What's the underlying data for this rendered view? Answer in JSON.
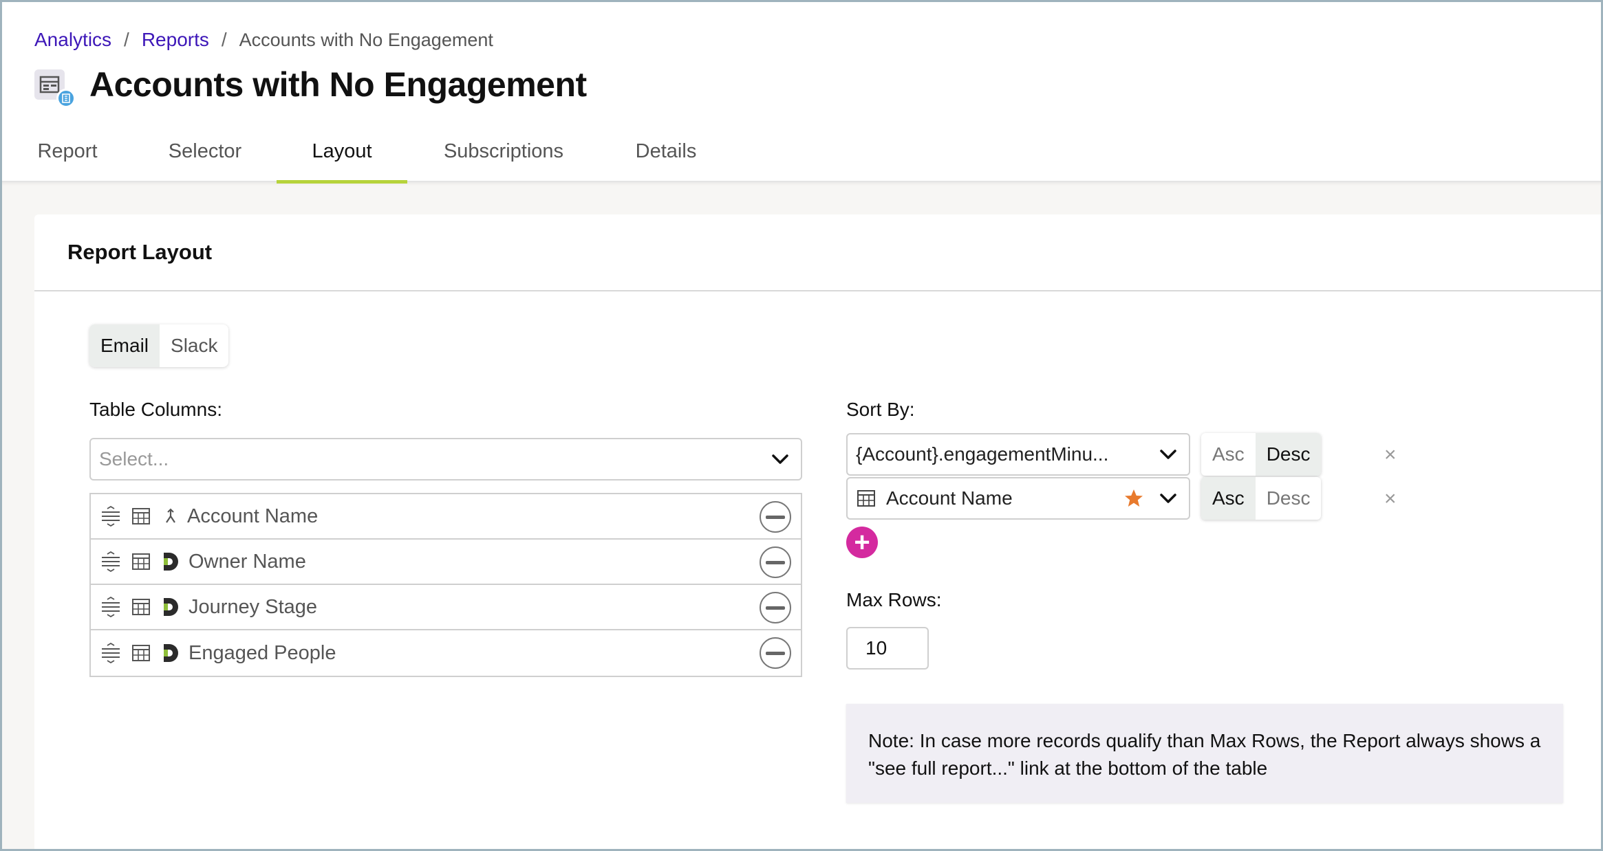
{
  "breadcrumb": {
    "items": [
      "Analytics",
      "Reports"
    ],
    "separator": "/",
    "current": "Accounts with No Engagement"
  },
  "page": {
    "title": "Accounts with No Engagement"
  },
  "tabs": [
    {
      "label": "Report"
    },
    {
      "label": "Selector"
    },
    {
      "label": "Layout",
      "active": true
    },
    {
      "label": "Subscriptions"
    },
    {
      "label": "Details"
    }
  ],
  "card": {
    "title": "Report Layout"
  },
  "channel_toggle": {
    "options": [
      "Email",
      "Slack"
    ],
    "selected": "Email"
  },
  "columns": {
    "label": "Table Columns:",
    "placeholder": "Select...",
    "items": [
      {
        "name": "Account Name",
        "source_icon": "merge-icon"
      },
      {
        "name": "Owner Name",
        "source_icon": "d-logo-icon"
      },
      {
        "name": "Journey Stage",
        "source_icon": "d-logo-icon"
      },
      {
        "name": "Engaged People",
        "source_icon": "d-logo-icon"
      }
    ]
  },
  "sort": {
    "label": "Sort By:",
    "rows": [
      {
        "field": "{Account}.engagementMinu...",
        "direction": "Desc"
      },
      {
        "field": "Account Name",
        "direction": "Asc",
        "starred": true
      }
    ],
    "asc_label": "Asc",
    "desc_label": "Desc",
    "remove_label": "×",
    "add_label": "+"
  },
  "max_rows": {
    "label": "Max Rows:",
    "value": "10"
  },
  "note": {
    "text": "Note: In case more records qualify than Max Rows, the Report always shows a \"see full report...\" link at the bottom of the table"
  },
  "colors": {
    "link": "#3d17b8",
    "tab_active": "#b6d33b",
    "add_button": "#d42a9f",
    "star": "#e87a2d"
  }
}
